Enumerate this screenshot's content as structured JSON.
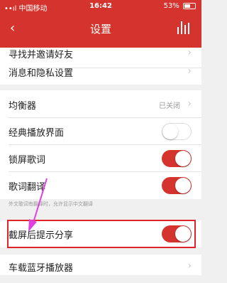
{
  "status_bar": {
    "carrier": "••ıl 中国移动",
    "time": "16:42",
    "battery": "53%"
  },
  "nav": {
    "back_icon": "‹",
    "title": "设置"
  },
  "rows_top": [
    {
      "label": "寻找并邀请好友",
      "chevron": "›"
    },
    {
      "label": "消息和隐私设置",
      "chevron": "›"
    }
  ],
  "equalizer": {
    "label": "均衡器",
    "value": "已关闭",
    "chevron": "›"
  },
  "toggles": [
    {
      "label": "经典播放界面",
      "on": false
    },
    {
      "label": "锁屏歌词",
      "on": true
    },
    {
      "label": "歌词翻译",
      "on": true
    }
  ],
  "note": "外文歌词有翻译时，允许显示中文翻译",
  "share_toggle": {
    "label": "截屏后提示分享",
    "on": true
  },
  "bottom": {
    "label": "车载蓝牙播放器",
    "chevron": "›"
  },
  "colors": {
    "accent": "#d4342d",
    "annotation": "#e040e0",
    "highlight": "#e0252a"
  }
}
